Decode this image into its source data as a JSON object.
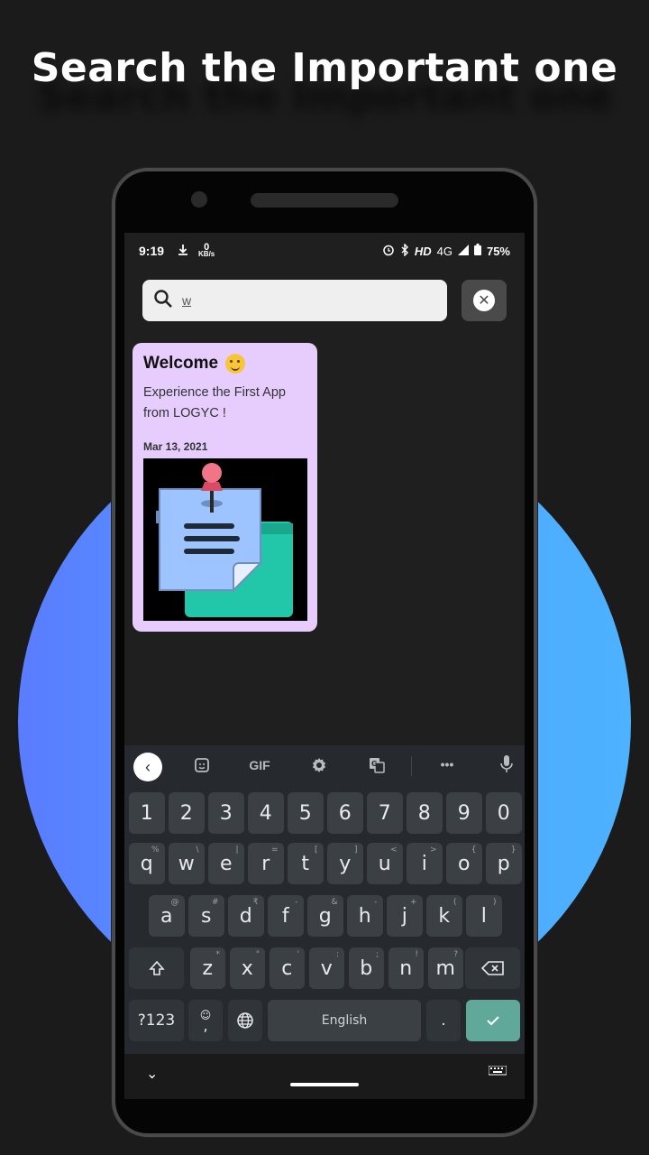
{
  "headline": "Search the Important one",
  "status_bar": {
    "time": "9:19",
    "speed_value": "0",
    "speed_unit": "KB/s",
    "network": "4G",
    "hd": "HD",
    "battery": "75%"
  },
  "search": {
    "value": "w"
  },
  "note": {
    "title": "Welcome",
    "body": "Experience the First App from LOGYC !",
    "date": "Mar 13, 2021"
  },
  "keyboard": {
    "toolbar": {
      "gif": "GIF",
      "more": "•••"
    },
    "row_numbers": [
      "1",
      "2",
      "3",
      "4",
      "5",
      "6",
      "7",
      "8",
      "9",
      "0"
    ],
    "row_top": [
      {
        "k": "q",
        "s": "%"
      },
      {
        "k": "w",
        "s": "\\"
      },
      {
        "k": "e",
        "s": "|"
      },
      {
        "k": "r",
        "s": "="
      },
      {
        "k": "t",
        "s": "["
      },
      {
        "k": "y",
        "s": "]"
      },
      {
        "k": "u",
        "s": "<"
      },
      {
        "k": "i",
        "s": ">"
      },
      {
        "k": "o",
        "s": "{"
      },
      {
        "k": "p",
        "s": "}"
      }
    ],
    "row_mid": [
      {
        "k": "a",
        "s": "@"
      },
      {
        "k": "s",
        "s": "#"
      },
      {
        "k": "d",
        "s": "₹"
      },
      {
        "k": "f",
        "s": "-"
      },
      {
        "k": "g",
        "s": "&"
      },
      {
        "k": "h",
        "s": "-"
      },
      {
        "k": "j",
        "s": "+"
      },
      {
        "k": "k",
        "s": "("
      },
      {
        "k": "l",
        "s": ")"
      }
    ],
    "row_bottom": [
      {
        "k": "z",
        "s": "*"
      },
      {
        "k": "x",
        "s": "\""
      },
      {
        "k": "c",
        "s": "'"
      },
      {
        "k": "v",
        "s": ":"
      },
      {
        "k": "b",
        "s": ";"
      },
      {
        "k": "n",
        "s": "!"
      },
      {
        "k": "m",
        "s": "?"
      }
    ],
    "symbols_label": "?123",
    "comma": ",",
    "space_label": "English",
    "period": ".",
    "enter_icon": "check-icon"
  },
  "colors": {
    "accent_blue": "#4fa3ff",
    "note_bg": "#e7cdfd",
    "enter_key": "#5fa89a"
  }
}
